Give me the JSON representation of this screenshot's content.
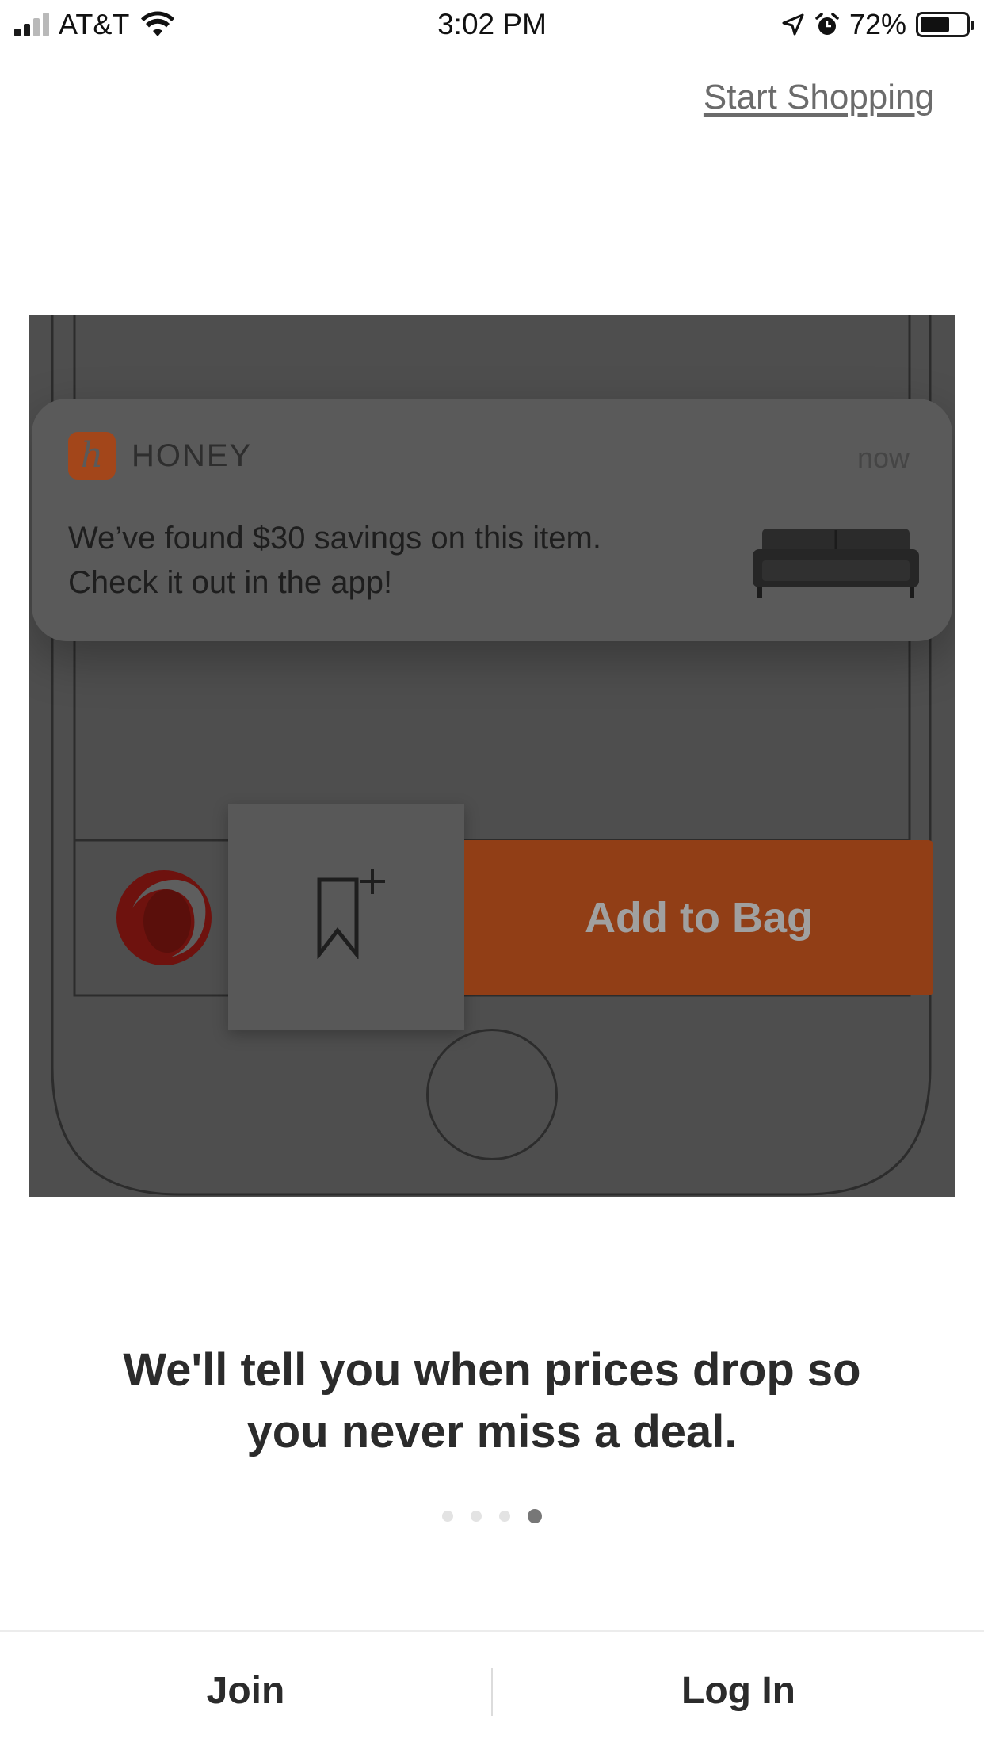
{
  "status_bar": {
    "carrier": "AT&T",
    "time": "3:02 PM",
    "battery_percent": "72%",
    "battery_level": 0.72,
    "signal_bars": 2,
    "icons": [
      "signal-icon",
      "wifi-icon",
      "location-arrow-icon",
      "alarm-icon",
      "battery-icon"
    ]
  },
  "header": {
    "start_shopping": "Start Shopping"
  },
  "illustration": {
    "notification": {
      "app_name": "HONEY",
      "app_icon_letter": "h",
      "time": "now",
      "message": "We’ve found $30 savings on this item.\nCheck it out in the app!"
    },
    "add_to_bag": "Add to Bag",
    "colors": {
      "add_to_bag": "#913e16",
      "honey_brand": "#a3461a",
      "logo_red": "#6e120e"
    }
  },
  "onboarding": {
    "headline": "We'll tell you when prices drop so\nyou never miss a deal.",
    "page_count": 4,
    "current_page": 4
  },
  "footer": {
    "join": "Join",
    "log_in": "Log In"
  }
}
